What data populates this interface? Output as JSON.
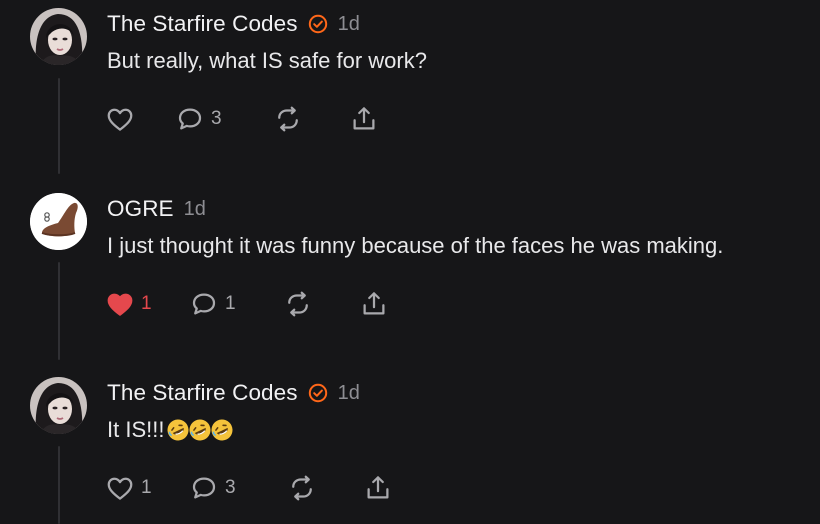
{
  "comments": [
    {
      "author": "The Starfire Codes",
      "verified": true,
      "time": "1d",
      "text": "But really, what IS safe for work?",
      "emoji_suffix": [],
      "likes": "",
      "liked": false,
      "replies": "3",
      "avatar": "woman-portrait-avatar"
    },
    {
      "author": "OGRE",
      "verified": false,
      "time": "1d",
      "text": "I just thought it was funny because of the faces he was making.",
      "emoji_suffix": [],
      "likes": "1",
      "liked": true,
      "replies": "1",
      "avatar": "saddle-avatar"
    },
    {
      "author": "The Starfire Codes",
      "verified": true,
      "time": "1d",
      "text": "It IS!!!",
      "emoji_suffix": [
        "rolling-on-floor-laughing-emoji",
        "rolling-on-floor-laughing-emoji",
        "rolling-on-floor-laughing-emoji"
      ],
      "likes": "1",
      "liked": false,
      "replies": "3",
      "avatar": "woman-portrait-avatar"
    }
  ],
  "icons": {
    "like": "heart-icon",
    "reply": "comment-bubble-icon",
    "restack": "restack-icon",
    "share": "share-icon",
    "verified": "verified-check-icon"
  },
  "colors": {
    "background": "#161618",
    "text": "#ececee",
    "muted": "#8e8e93",
    "verified": "#ff6719",
    "liked": "#e5484d",
    "thread_line": "#303034"
  }
}
